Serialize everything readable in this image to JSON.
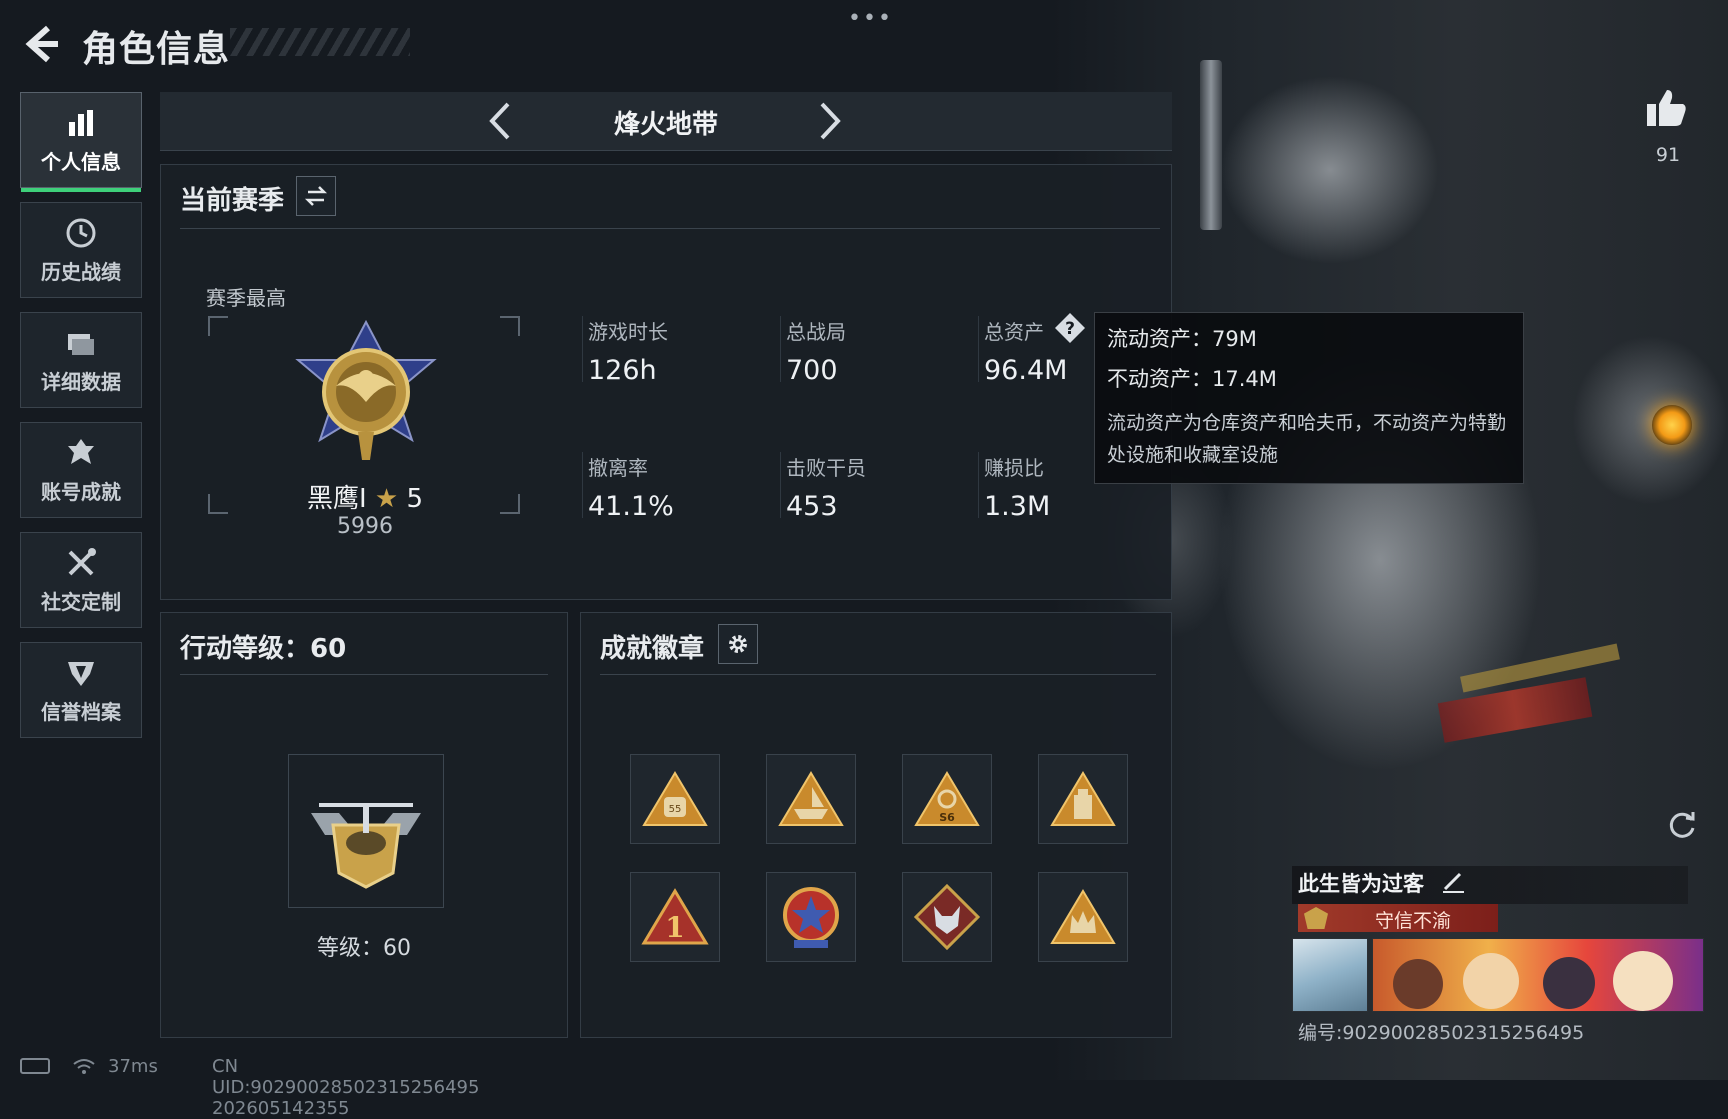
{
  "header": {
    "title": "角色信息",
    "back_icon": "back-arrow-icon",
    "more_icon": "more-dots-icon",
    "more_text": "•••"
  },
  "sidebar": {
    "items": [
      {
        "label": "个人信息",
        "icon": "bar-chart-icon",
        "active": true
      },
      {
        "label": "历史战绩",
        "icon": "history-clock-icon",
        "active": false
      },
      {
        "label": "详细数据",
        "icon": "folder-icon",
        "active": false
      },
      {
        "label": "账号成就",
        "icon": "medal-icon",
        "active": false
      },
      {
        "label": "社交定制",
        "icon": "tools-icon",
        "active": false
      },
      {
        "label": "信誉档案",
        "icon": "shield-icon",
        "active": false
      }
    ]
  },
  "mode": {
    "title": "烽火地带",
    "prev_icon": "chevron-left-icon",
    "next_icon": "chevron-right-icon"
  },
  "season": {
    "title": "当前赛季",
    "switch_icon": "swap-icon",
    "best_label": "赛季最高",
    "rank_name": "黑鹰I",
    "rank_stars": "5",
    "rank_score": "5996",
    "stats": [
      {
        "label": "游戏时长",
        "value": "126h"
      },
      {
        "label": "总战局",
        "value": "700"
      },
      {
        "label": "总资产",
        "value": "96.4M",
        "help": true
      },
      {
        "label": "撤离率",
        "value": "41.1%"
      },
      {
        "label": "击败干员",
        "value": "453"
      },
      {
        "label": "赚损比",
        "value": "1.3M"
      }
    ]
  },
  "tooltip": {
    "liquid": "流动资产：79M",
    "fixed": "不动资产：17.4M",
    "desc": "流动资产为仓库资产和哈夫币，不动资产为特勤处设施和收藏室设施"
  },
  "action_level": {
    "title": "行动等级：60",
    "level_text": "等级：60"
  },
  "achievements": {
    "title": "成就徽章",
    "settings_icon": "gear-icon",
    "badges": [
      "bag-55-badge-icon",
      "boat-badge-icon",
      "s6-badge-icon",
      "crate-badge-icon",
      "number-one-badge-icon",
      "star-medal-badge-icon",
      "wolf-badge-icon",
      "crown-badge-icon"
    ]
  },
  "profile": {
    "likes": "91",
    "player_name": "此生皆为过客",
    "title_tag": "守信不渝",
    "serial": "编号:90290028502315256495"
  },
  "footer": {
    "ping": "37ms",
    "uid": "CN UID:90290028502315256495  202605142355"
  },
  "colors": {
    "accent_green": "#3ed07a",
    "gold": "#c9a24a",
    "tag_red": "#a13a2a",
    "bg": "#151a20"
  }
}
